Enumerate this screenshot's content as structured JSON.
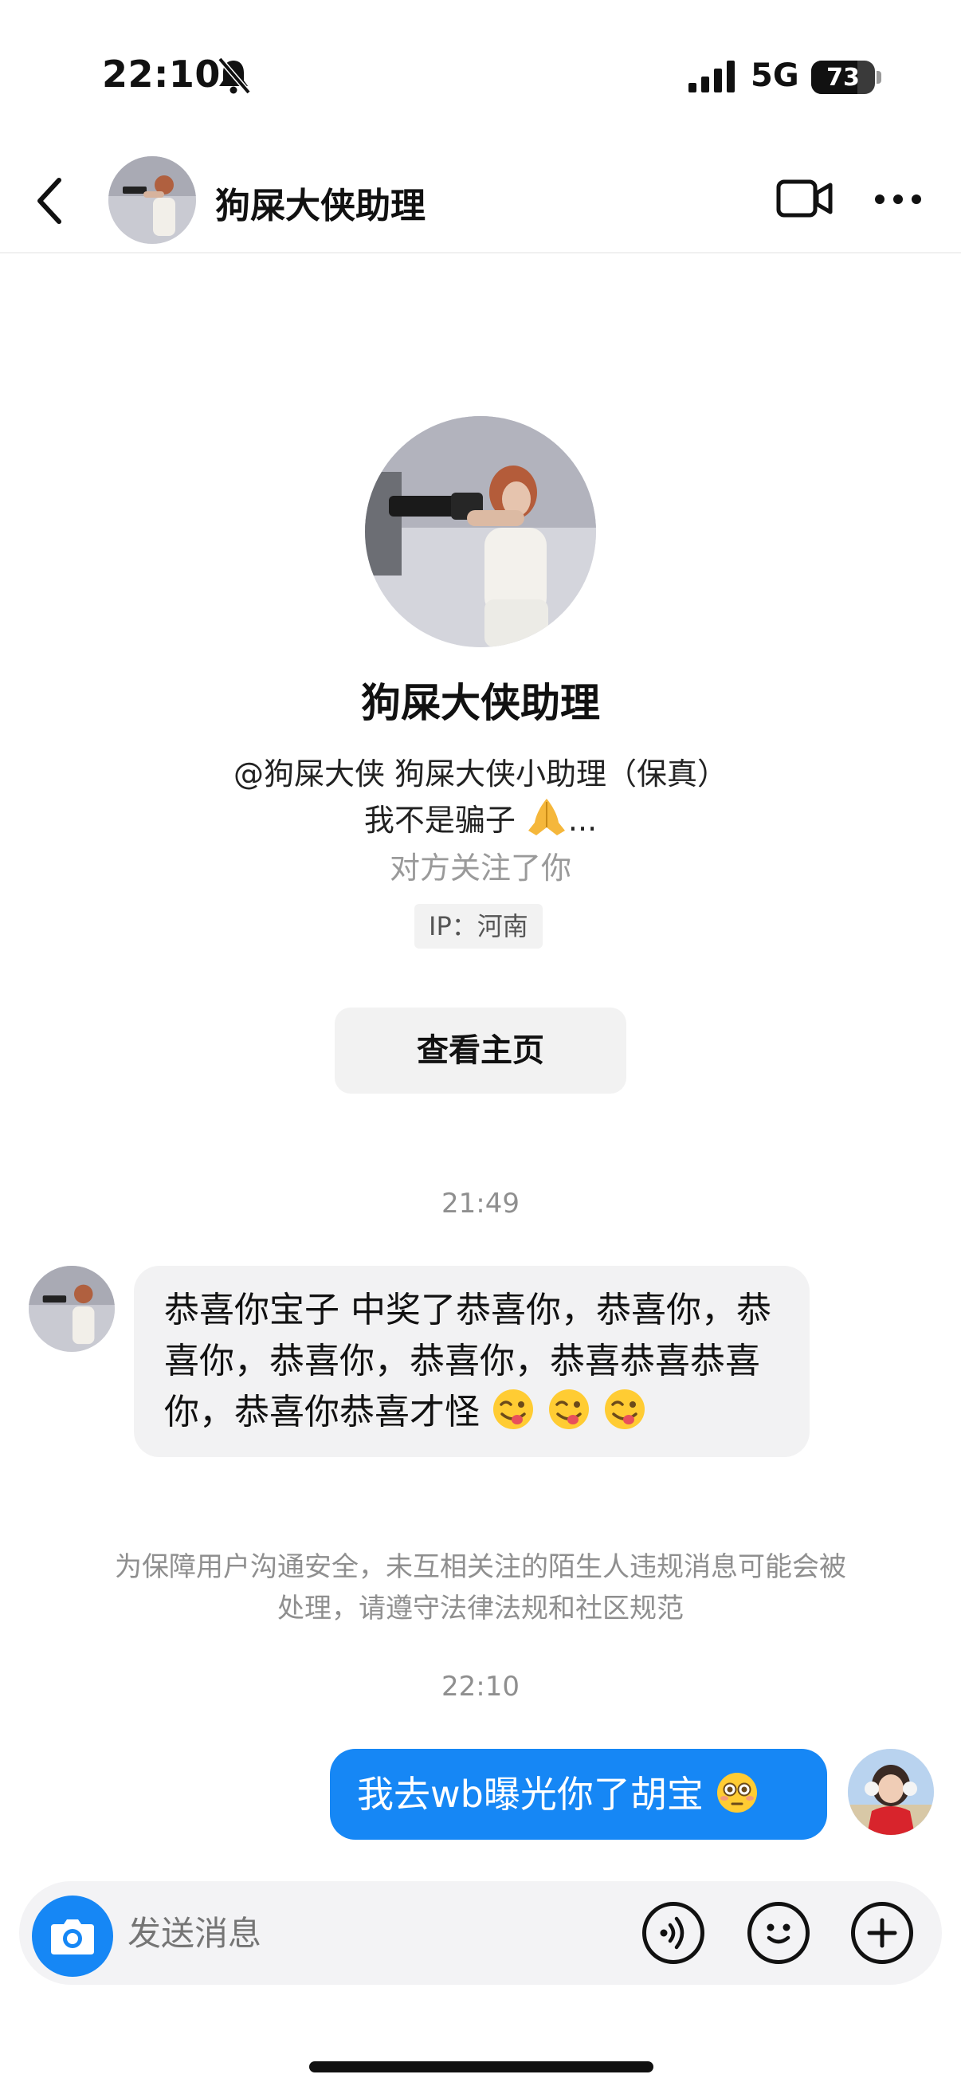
{
  "status_bar": {
    "time": "22:10",
    "network": "5G",
    "battery": "73",
    "battery_level": 0.73
  },
  "header": {
    "title": "狗屎大侠助理"
  },
  "profile": {
    "name": "狗屎大侠助理",
    "bio_line1": "@狗屎大侠 狗屎大侠小助理（保真）",
    "bio_line2": "我不是骗子",
    "bio_ellipsis": "...",
    "follow_note": "对方关注了你",
    "ip": "IP：河南",
    "view_button": "查看主页"
  },
  "messages": {
    "time1": "21:49",
    "incoming_text": "恭喜你宝子 中奖了恭喜你，恭喜你，恭喜你，恭喜你，恭喜你，恭喜恭喜恭喜你，恭喜你恭喜才怪",
    "notice": "为保障用户沟通安全，未互相关注的陌生人违规消息可能会被处理，请遵守法律法规和社区规范",
    "time2": "22:10",
    "outgoing_text": "我去wb曝光你了胡宝"
  },
  "input": {
    "placeholder": "发送消息"
  },
  "icons": {
    "back": "chevron-left-icon",
    "video": "video-call-icon",
    "more": "more-dots-icon",
    "mute": "bell-slash-icon",
    "camera": "camera-icon",
    "voice": "voice-icon",
    "emoji": "emoji-icon",
    "plus": "plus-icon"
  },
  "colors": {
    "accent": "#1687f5",
    "bubble_in": "#f2f2f3",
    "muted_text": "#8f8f8f"
  }
}
